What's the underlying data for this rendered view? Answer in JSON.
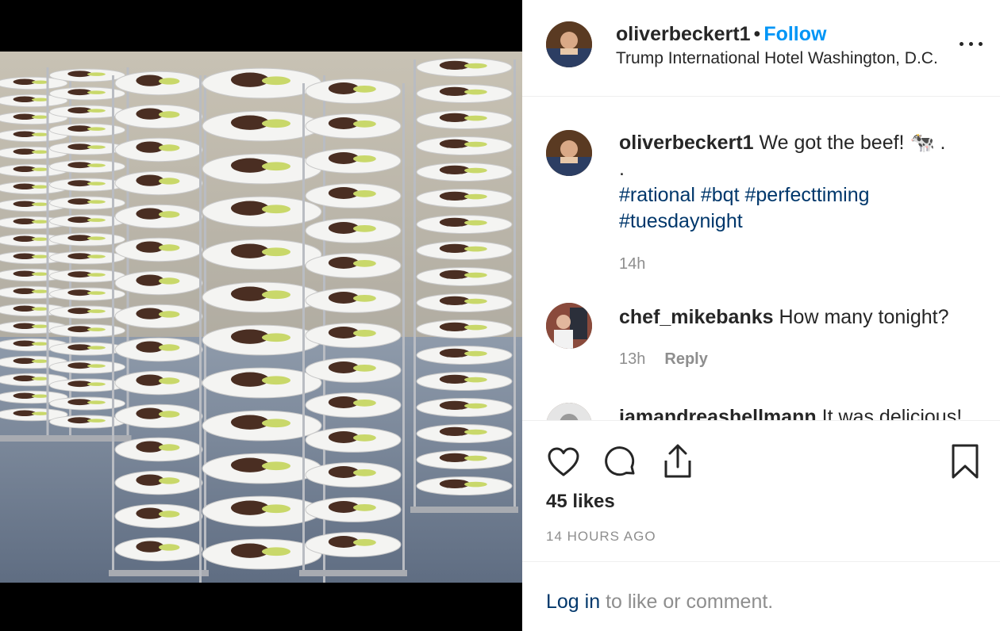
{
  "post": {
    "username": "oliverbeckert1",
    "separator": "•",
    "follow_label": "Follow",
    "location": "Trump International Hotel Washington, D.C.",
    "more_icon": "more-options-icon"
  },
  "caption": {
    "username": "oliverbeckert1",
    "text": "We got the beef! 🐄 .",
    "dot_line": ".",
    "hashtags": [
      "#rational",
      "#bqt",
      "#perfecttiming",
      "#tuesdaynight"
    ],
    "time": "14h"
  },
  "comments": [
    {
      "username": "chef_mikebanks",
      "text": "How many tonight?",
      "time": "13h",
      "reply_label": "Reply"
    },
    {
      "username": "iamandreashellmann",
      "text": "It was delicious!"
    }
  ],
  "actions": {
    "like_icon": "heart-icon",
    "comment_icon": "comment-icon",
    "share_icon": "share-icon",
    "save_icon": "bookmark-icon",
    "likes": "45 likes",
    "time_ago": "14 HOURS AGO"
  },
  "footer": {
    "login_label": "Log in",
    "login_suffix": " to like or comment."
  },
  "colors": {
    "follow": "#0095f6",
    "hashtag": "#00376b",
    "muted": "#8e8e8e",
    "text": "#262626"
  }
}
